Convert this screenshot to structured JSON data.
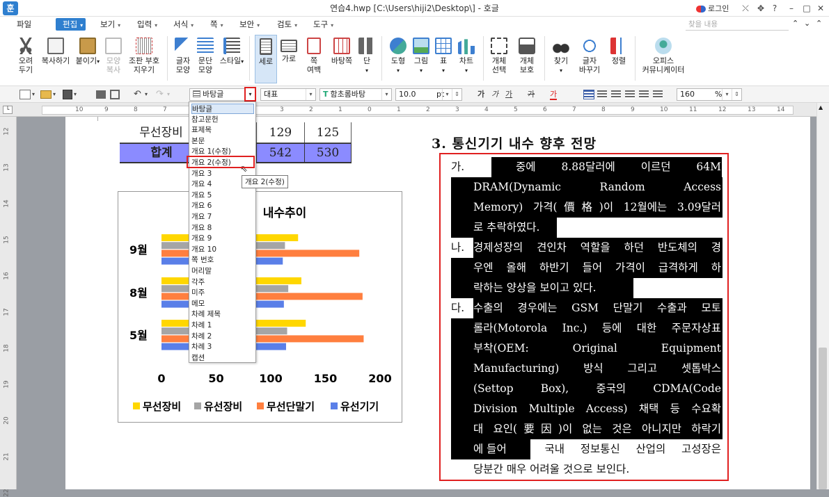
{
  "window": {
    "logo": "훈",
    "title": "연습4.hwp [C:\\Users\\hiji2\\Desktop\\] - 호글",
    "login": "로그인",
    "controls": [
      "⤬",
      "✥",
      "?",
      "–",
      "□",
      "✕"
    ]
  },
  "menu": {
    "file": "파일",
    "edit": "편집",
    "items": [
      "보기",
      "입력",
      "서식",
      "쪽",
      "보안",
      "검토",
      "도구"
    ],
    "search_placeholder": "찾을 내용",
    "nav": [
      "⌃",
      "⌄",
      "⌃"
    ]
  },
  "ribbon": {
    "cut": [
      "오려",
      "두기"
    ],
    "copy": "복사하기",
    "paste": "붙이기",
    "format_copy": [
      "모양",
      "복사"
    ],
    "combine": [
      "조판 부호",
      "지우기"
    ],
    "char_shape": [
      "글자",
      "모양"
    ],
    "para_shape": [
      "문단",
      "모양"
    ],
    "style": "스타일",
    "vertical": "세로",
    "horizontal": "가로",
    "page_margin": [
      "쪽",
      "여백"
    ],
    "bg": "바탕쪽",
    "columns": "단",
    "shape": "도형",
    "picture": "그림",
    "table": "표",
    "chart": "차트",
    "object_select": [
      "개체",
      "선택"
    ],
    "object_protect": [
      "개체",
      "보호"
    ],
    "find": "찾기",
    "replace": [
      "글자",
      "바꾸기"
    ],
    "sort": "정렬",
    "office": [
      "오피스",
      "커뮤니케이터"
    ]
  },
  "toolbar": {
    "style_value": "바탕글",
    "lang_value": "대표",
    "font_value": "함초롬바탕",
    "size_value": "10.0",
    "size_unit": "pt",
    "zoom_value": "160",
    "zoom_unit": "%"
  },
  "ruler": {
    "numbers": [
      "10",
      "9",
      "8",
      "7",
      "6",
      "5",
      "4",
      "3",
      "2",
      "1",
      "0",
      "1",
      "2",
      "3",
      "4",
      "5",
      "6",
      "7",
      "8",
      "9",
      "10",
      "11",
      "12",
      "13",
      "14"
    ],
    "vnumbers": [
      "12",
      "13",
      "14",
      "15",
      "16",
      "17",
      "18",
      "19",
      "20",
      "21",
      "22"
    ]
  },
  "table": {
    "row1": {
      "label": "무선장비",
      "v1": "129",
      "v2": "125"
    },
    "row2": {
      "label": "합계",
      "v1": "542",
      "v2": "530"
    }
  },
  "chart_data": {
    "type": "bar",
    "orientation": "horizontal",
    "title": "내수추이",
    "categories": [
      "9월",
      "8월",
      "5월"
    ],
    "series": [
      {
        "name": "무선장비",
        "color": "#ffd700",
        "values": [
          125,
          128,
          132
        ]
      },
      {
        "name": "유선장비",
        "color": "#a5a5a5",
        "values": [
          113,
          116,
          115
        ]
      },
      {
        "name": "무선단말기",
        "color": "#ff7f3f",
        "values": [
          181,
          184,
          185
        ]
      },
      {
        "name": "유선기기",
        "color": "#5a7fe8",
        "values": [
          111,
          112,
          114
        ]
      }
    ],
    "xlim": [
      0,
      200
    ],
    "xticks": [
      "0",
      "50",
      "100",
      "150",
      "200"
    ],
    "legend": "bottom"
  },
  "style_list": {
    "items": [
      "바탕글",
      "참고문헌",
      "표제목",
      "본문",
      "개요 1(수정)",
      "개요 2(수정)",
      "개요 3",
      "개요 4",
      "개요 5",
      "개요 6",
      "개요 7",
      "개요 8",
      "개요 9",
      "개요 10",
      "쪽 번호",
      "머리말",
      "각주",
      "미주",
      "메모",
      "차례 제목",
      "차례 1",
      "차례 2",
      "차례 3",
      "캡션"
    ],
    "tooltip": "개요 2(수정)"
  },
  "doc": {
    "heading": "3. 통신기기 내수 향후 전망",
    "markers": [
      "가.",
      "나.",
      "다."
    ],
    "lines": [
      {
        "m": 0,
        "t": "7월 중에 8.88달러에 이르던 64M",
        "sel": "part"
      },
      {
        "t": "DRAM(Dynamic Random Access"
      },
      {
        "t": "Memory) 가격(價格)이 12월에는 3.09달러"
      },
      {
        "t": "로 추락하였다."
      },
      {
        "m": 1,
        "t": "경제성장의 견인차 역할을 하던 반도체의 경"
      },
      {
        "t": "우엔 올해 하반기 들어 가격이 급격하게 하"
      },
      {
        "t": "락하는 양상을 보이고 있다."
      },
      {
        "m": 2,
        "t": "수출의 경우에는 GSM 단말기 수출과 모토"
      },
      {
        "t": "롤라(Motorola Inc.) 등에 대한 주문자상표"
      },
      {
        "t": "부착(OEM: Original Equipment"
      },
      {
        "t": "Manufacturing) 방식 그리고 셋톱박스"
      },
      {
        "t": "(Settop Box), 중국의 CDMA(Code"
      },
      {
        "t": "Division Multiple Access) 채택 등 수요확"
      },
      {
        "t": "대 요인(要因)이 없는 것은 아니지만 하락기"
      },
      {
        "t": "에 들어간 국내 정보통신 산업의 고성장은",
        "sel": "part2"
      },
      {
        "t": "당분간 매우 어려울 것으로 보인다.",
        "sel": "none"
      }
    ]
  }
}
